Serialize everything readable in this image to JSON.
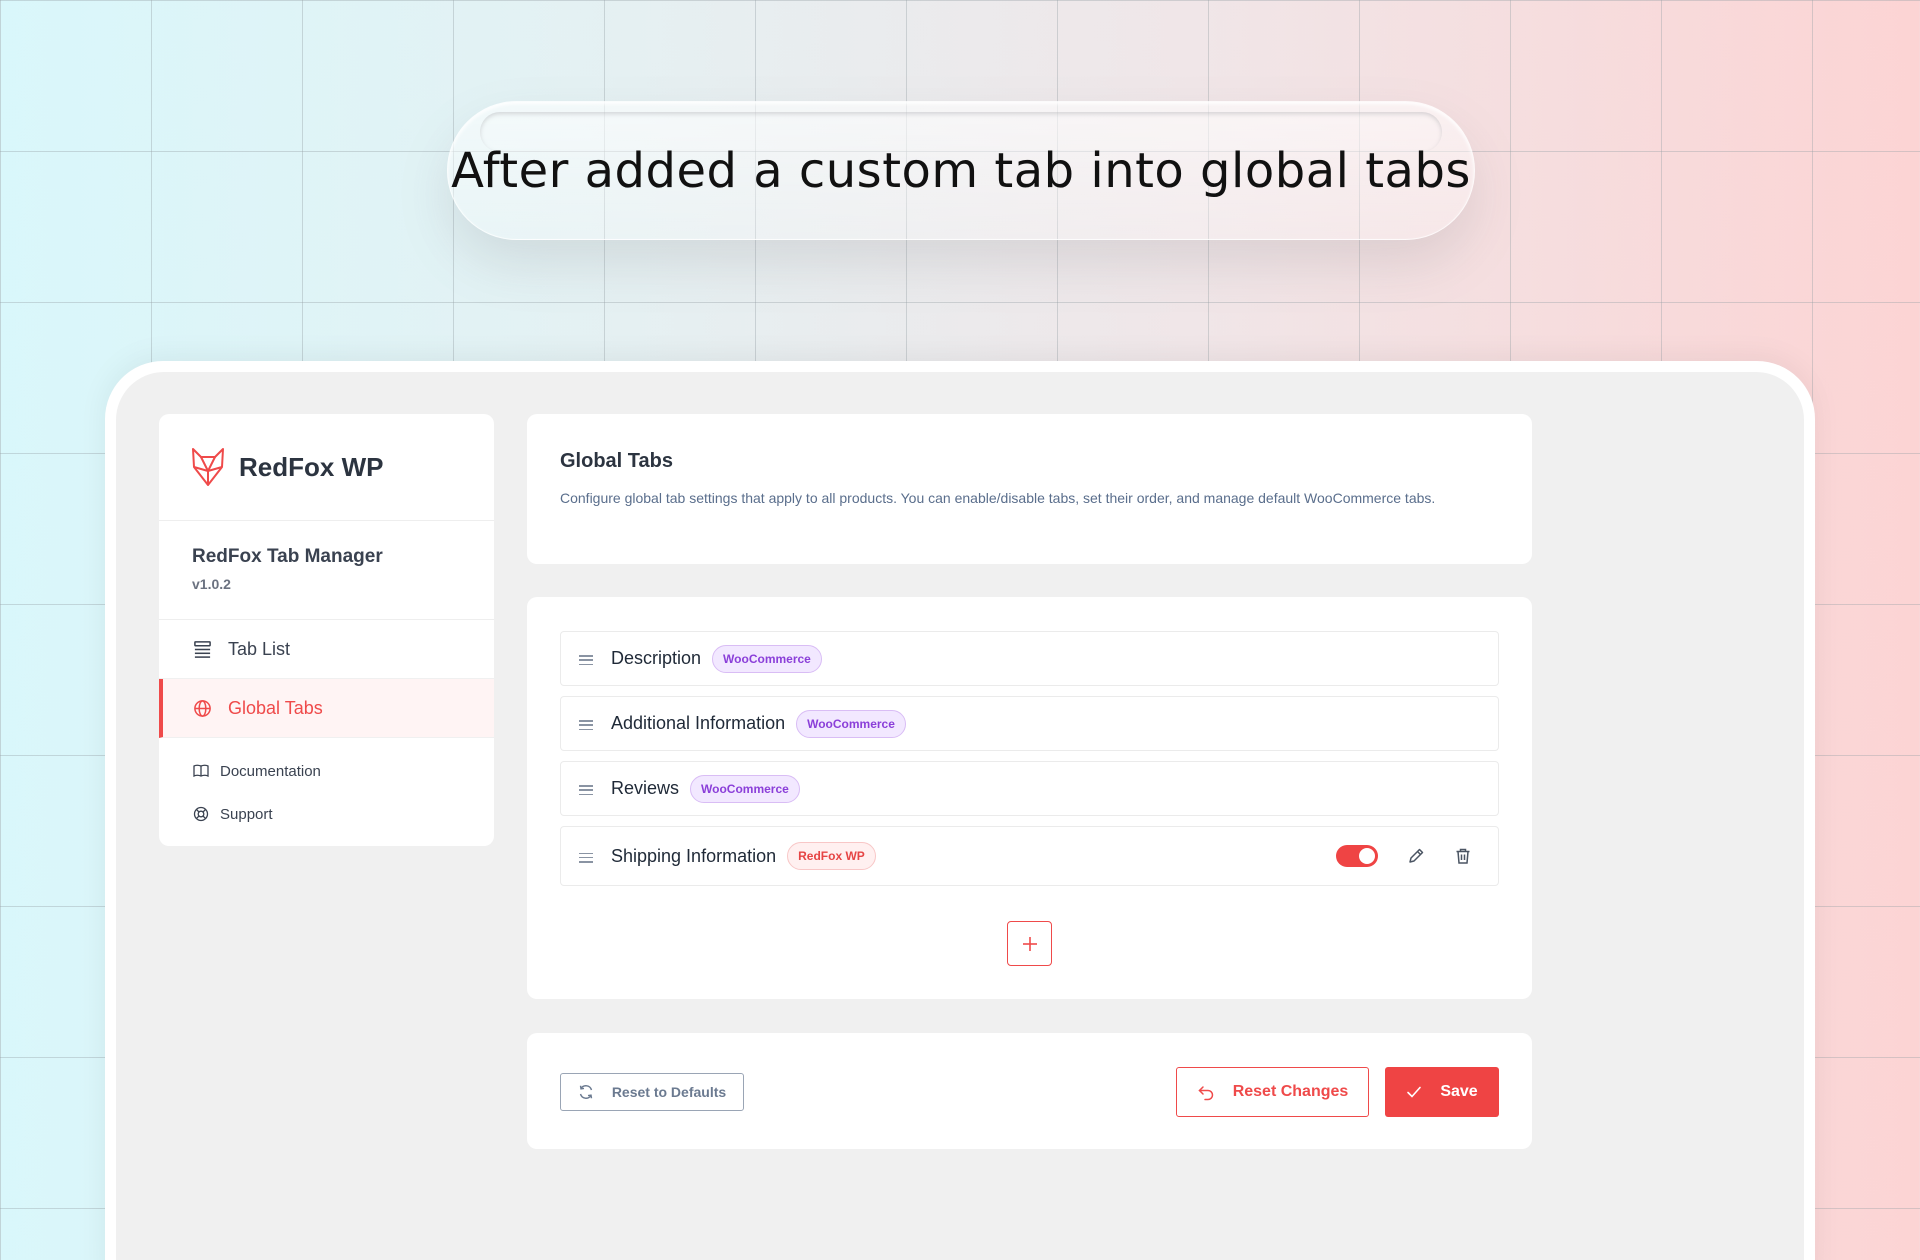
{
  "caption": "After  added a custom tab into global tabs",
  "brand": {
    "name": "RedFox WP",
    "icon": "fox-logo-icon"
  },
  "plugin": {
    "name": "RedFox Tab Manager",
    "version": "v1.0.2"
  },
  "sidebar": {
    "nav": [
      {
        "label": "Tab List",
        "icon": "list-icon",
        "active": false
      },
      {
        "label": "Global Tabs",
        "icon": "globe-icon",
        "active": true
      }
    ],
    "links": [
      {
        "label": "Documentation",
        "icon": "book-icon"
      },
      {
        "label": "Support",
        "icon": "lifebuoy-icon"
      }
    ]
  },
  "header": {
    "title": "Global Tabs",
    "description": "Configure global tab settings that apply to all products. You can enable/disable tabs, set their order, and manage default WooCommerce tabs."
  },
  "tabs": [
    {
      "name": "Description",
      "badge": "WooCommerce",
      "type": "woo"
    },
    {
      "name": "Additional Information",
      "badge": "WooCommerce",
      "type": "woo"
    },
    {
      "name": "Reviews",
      "badge": "WooCommerce",
      "type": "woo"
    },
    {
      "name": "Shipping Information",
      "badge": "RedFox WP",
      "type": "custom",
      "enabled": true
    }
  ],
  "footer": {
    "reset_defaults": "Reset to Defaults",
    "reset_changes": "Reset Changes",
    "save": "Save"
  },
  "colors": {
    "accent": "#ef4444",
    "woo_badge": "#8b3fd9",
    "text": "#2c3440"
  }
}
